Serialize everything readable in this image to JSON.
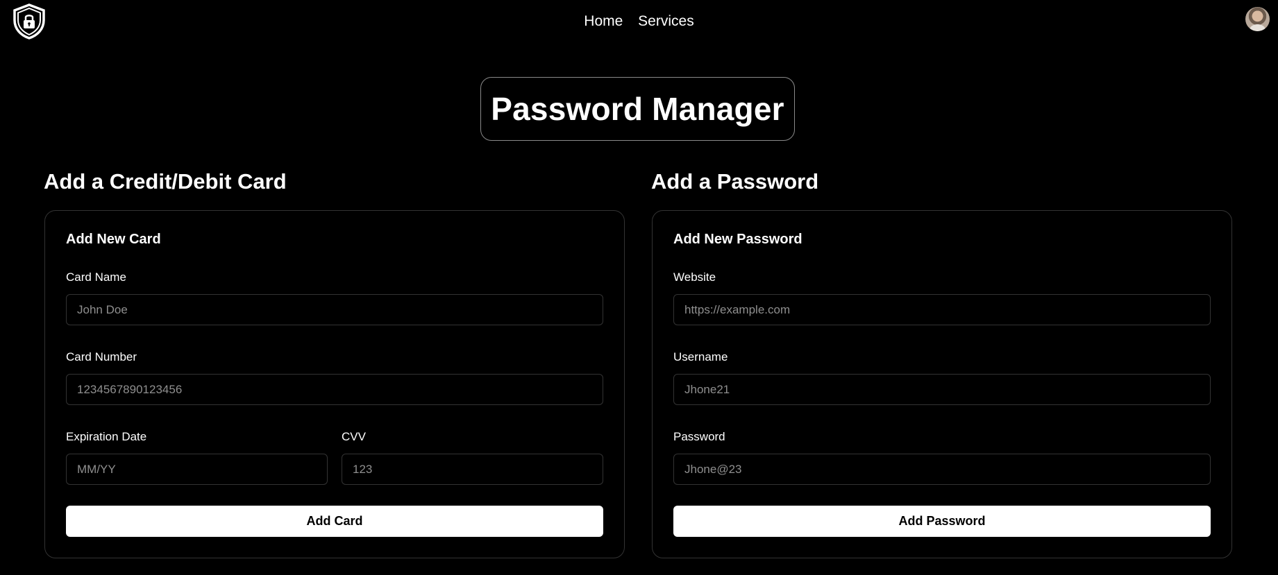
{
  "nav": {
    "links": [
      "Home",
      "Services"
    ]
  },
  "page_title": "Password Manager",
  "card_section": {
    "heading": "Add a Credit/Debit Card",
    "form_title": "Add New Card",
    "fields": {
      "card_name": {
        "label": "Card Name",
        "placeholder": "John Doe"
      },
      "card_number": {
        "label": "Card Number",
        "placeholder": "1234567890123456"
      },
      "expiration": {
        "label": "Expiration Date",
        "placeholder": "MM/YY"
      },
      "cvv": {
        "label": "CVV",
        "placeholder": "123"
      }
    },
    "submit_label": "Add Card"
  },
  "password_section": {
    "heading": "Add a Password",
    "form_title": "Add New Password",
    "fields": {
      "website": {
        "label": "Website",
        "placeholder": "https://example.com"
      },
      "username": {
        "label": "Username",
        "placeholder": "Jhone21"
      },
      "password": {
        "label": "Password",
        "placeholder": "Jhone@23"
      }
    },
    "submit_label": "Add Password"
  },
  "icons": {
    "logo": "shield-lock-icon",
    "avatar": "user-avatar"
  }
}
